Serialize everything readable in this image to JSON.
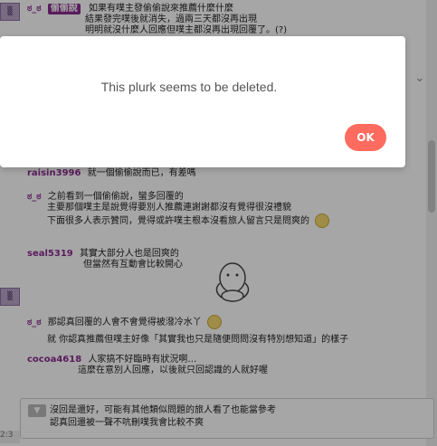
{
  "responses": [
    {
      "user": "ಠ_ಠ",
      "tag": "偷偷說",
      "lines": [
        "如果有噗主發偷偷說來推薦什麼什麼",
        "結果發完噗後就消失，過兩三天都沒再出現",
        "明明就沒什麼人回應但噗主都沒再出現回覆了。(?)"
      ]
    },
    {
      "user": "raisin3996",
      "lines": [
        "就一個偷偷說而已，有差嗎"
      ]
    },
    {
      "user": "ಠ_ಠ",
      "lines": [
        "之前看到一個偷偷說，蠻多回覆的",
        "主要那個噗主是說覺得要別人推薦連謝謝都沒有覺得很沒禮貌",
        "下面很多人表示贊同，覺得或許噗主根本沒看旅人留言只是問爽的"
      ]
    },
    {
      "user": "seal5319",
      "lines": [
        "其實大部分人也是回爽的",
        "但當然有互動會比較開心"
      ]
    },
    {
      "user": "ಠ_ಠ",
      "lines": [
        "那認真回覆的人會不會覺得被潑冷水丫",
        "就 你認真推薦但噗主好像「其實我也只是隨便問問沒有特別想知道」的樣子"
      ]
    },
    {
      "user": "cocoa4618",
      "lines": [
        "人家搞不好臨時有狀況啊…",
        "這麼在意別人回應，以後就只回認識的人就好喔"
      ]
    }
  ],
  "reply": {
    "line1": "沒回是還好，可能有其他類似問題的旅人看了也能當參考",
    "line2": "認真回還被一聲不吭刪噗我會比較不爽"
  },
  "timestamp": "2:3",
  "dialog": {
    "message": "This plurk seems to be deleted.",
    "ok_label": "OK"
  },
  "colors": {
    "username": "#8a2b8f",
    "ok_button": "#ff6b5f"
  },
  "icons": {
    "emoji": "smiley-icon",
    "sticker": "cartoon-hug-sticker"
  }
}
